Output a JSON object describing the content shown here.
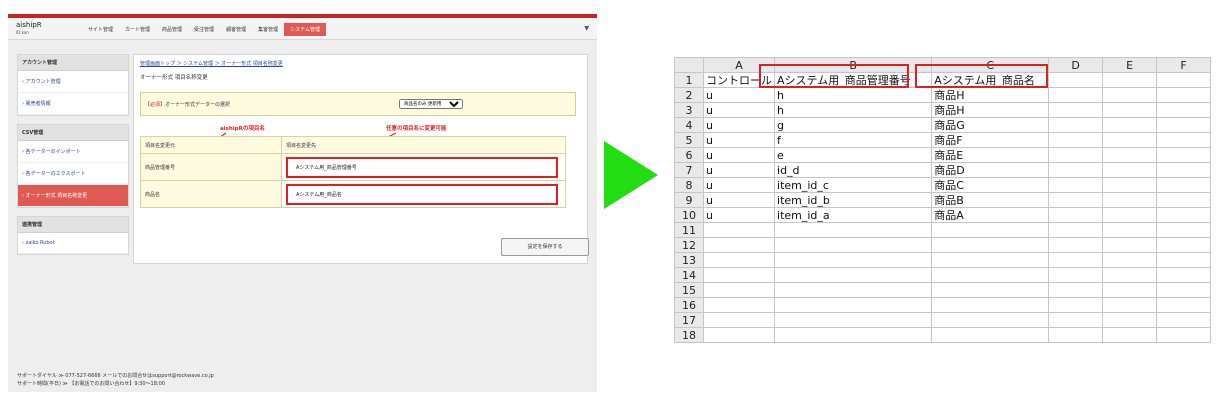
{
  "app": {
    "logo": "aishipR",
    "logo_sub": "ID:kan",
    "nav": [
      "サイト管理",
      "カート管理",
      "商品管理",
      "受注管理",
      "顧客管理",
      "集客管理",
      "システム管理"
    ],
    "dropdown_glyph": "▼",
    "sidebar": [
      {
        "header": "アカウント管理",
        "items": [
          "アカウント管理",
          "販売者情報"
        ]
      },
      {
        "header": "CSV管理",
        "items": [
          "各データーのインポート",
          "各データーのエクスポート",
          "オーナー形式 項目名称変更"
        ]
      },
      {
        "header": "連携管理",
        "items": [
          "zaiko Robot"
        ]
      }
    ],
    "breadcrumb": "管理画面トップ ＞ システム管理 ＞ オーナー形式 項目名称変更",
    "page_title": "オーナー形式 項目名称変更",
    "required_label": "【必須】",
    "required_text": "オーナー形式データーの選択",
    "select_value": "商品名のみ 更新用",
    "col_headers": [
      "項目名変更元",
      "項目名変更先"
    ],
    "rows": [
      {
        "from": "商品管理番号",
        "to": "Aシステム用_商品管理番号"
      },
      {
        "from": "商品名",
        "to": "Aシステム用_商品名"
      }
    ],
    "annotation_left": "aishipRの項目名",
    "annotation_right": "任意の項目名に変更可能",
    "save_button": "設定を保存する",
    "footer_line1": "サポートダイヤル ≫ 077-527-6666 メールでのお問合せはsupport@rockwave.co.jp",
    "footer_line2": "サポート時間(平日) ≫ 【お電話でのお問い合わせ】9:30～18:00"
  },
  "sheet": {
    "columns": [
      "",
      "A",
      "B",
      "C",
      "D",
      "E",
      "F"
    ],
    "rows": [
      [
        "1",
        "コントロール",
        "Aシステム用_商品管理番号",
        "Aシステム用_商品名",
        "",
        "",
        ""
      ],
      [
        "2",
        "u",
        "h",
        "商品H",
        "",
        "",
        ""
      ],
      [
        "3",
        "u",
        "h",
        "商品H",
        "",
        "",
        ""
      ],
      [
        "4",
        "u",
        "g",
        "商品G",
        "",
        "",
        ""
      ],
      [
        "5",
        "u",
        "f",
        "商品F",
        "",
        "",
        ""
      ],
      [
        "6",
        "u",
        "e",
        "商品E",
        "",
        "",
        ""
      ],
      [
        "7",
        "u",
        "id_d",
        "商品D",
        "",
        "",
        ""
      ],
      [
        "8",
        "u",
        "item_id_c",
        "商品C",
        "",
        "",
        ""
      ],
      [
        "9",
        "u",
        "item_id_b",
        "商品B",
        "",
        "",
        ""
      ],
      [
        "10",
        "u",
        "item_id_a",
        "商品A",
        "",
        "",
        ""
      ],
      [
        "11",
        "",
        "",
        "",
        "",
        "",
        ""
      ],
      [
        "12",
        "",
        "",
        "",
        "",
        "",
        ""
      ],
      [
        "13",
        "",
        "",
        "",
        "",
        "",
        ""
      ],
      [
        "14",
        "",
        "",
        "",
        "",
        "",
        ""
      ],
      [
        "15",
        "",
        "",
        "",
        "",
        "",
        ""
      ],
      [
        "16",
        "",
        "",
        "",
        "",
        "",
        ""
      ],
      [
        "17",
        "",
        "",
        "",
        "",
        "",
        ""
      ],
      [
        "18",
        "",
        "",
        "",
        "",
        "",
        ""
      ]
    ]
  },
  "colors": {
    "accent": "#e05a55",
    "highlight": "#e02020",
    "arrow": "#22dd11"
  }
}
